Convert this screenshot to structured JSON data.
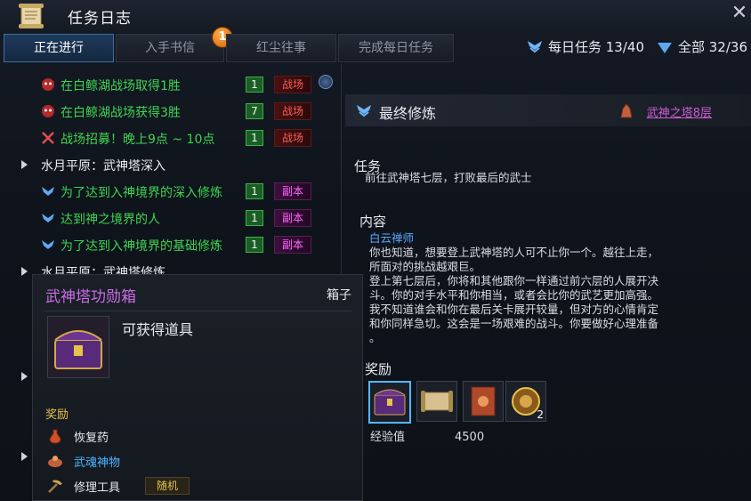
{
  "window": {
    "title": "任务日志",
    "close_icon": "close-icon"
  },
  "tabs": [
    {
      "label": "正在进行"
    },
    {
      "label": "入手书信",
      "badge": "1"
    },
    {
      "label": "红尘往事"
    },
    {
      "label": "完成每日任务"
    }
  ],
  "header_stats": {
    "daily_label": "每日任务 13/40",
    "all_label": "全部 32/36"
  },
  "quests": [
    {
      "text": "在白鲸湖战场取得1胜",
      "level": "1",
      "type": "战场",
      "type_color": "red"
    },
    {
      "text": "在白鲸湖战场获得3胜",
      "level": "7",
      "type": "战场",
      "type_color": "red"
    },
    {
      "text": "战场招募！晚上9点 ~ 10点",
      "level": "1",
      "type": "战场",
      "type_color": "red"
    },
    {
      "group": "水月平原：武神塔深入"
    },
    {
      "text": "为了达到入神境界的深入修炼",
      "level": "1",
      "type": "副本",
      "type_color": "pink"
    },
    {
      "text": "达到神之境界的人",
      "level": "1",
      "type": "副本",
      "type_color": "pink"
    },
    {
      "text": "为了达到入神境界的基础修炼",
      "level": "1",
      "type": "副本",
      "type_color": "pink"
    },
    {
      "group": "水月平原：武神塔修炼"
    }
  ],
  "detail": {
    "title": "最终修炼",
    "location_link": "武神之塔8层",
    "task_heading": "任务",
    "task_text": "前往武神塔七层，打败最后的武士",
    "content_heading": "内容",
    "speaker": "白云禅师",
    "content_lines": [
      "你也知道，想要登上武神塔的人可不止你一个。越往上走，",
      "所面对的挑战越艰巨。",
      "登上第七层后，你将和其他跟你一样通过前六层的人展开决",
      "斗。你的对手水平和你相当，或者会比你的武艺更加高强。",
      "我不知道谁会和你在最后关卡展开较量，但对方的心情肯定",
      "和你同样急切。这会是一场艰难的战斗。你要做好心理准备",
      "。"
    ],
    "reward_heading": "奖励",
    "reward_items": [
      {
        "icon": "treasure-chest-icon"
      },
      {
        "icon": "scroll-icon"
      },
      {
        "icon": "book-icon"
      },
      {
        "icon": "medallion-icon",
        "count": "2"
      }
    ],
    "exp_label": "经验值",
    "exp_value": "4500"
  },
  "tooltip": {
    "title": "武神塔功勋箱",
    "kind": "箱子",
    "subtitle": "可获得道具",
    "reward_heading": "奖励",
    "items": [
      {
        "label": "恢复药",
        "icon": "potion-icon"
      },
      {
        "label": "武魂神物",
        "icon": "soul-item-icon"
      },
      {
        "label": "修理工具",
        "icon": "pickaxe-icon",
        "tag": "随机"
      }
    ]
  }
}
